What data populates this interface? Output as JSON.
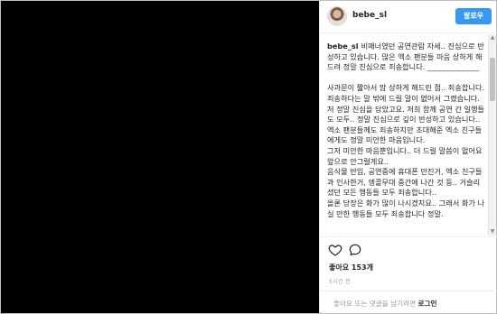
{
  "header": {
    "username": "bebe_sl",
    "follow_label": "팔로우"
  },
  "caption": {
    "username": "bebe_sl",
    "paragraphs": [
      "비매너였던 공연관람 자세.. 진심으로 반성하고 있습니다. 많은 엑소 팬분들 마음 상하게 해드려 정말 진심으로 죄송합니다. ______________",
      "",
      "사과문이 짧아서 맘 상하게 해드린 점.. 죄송합니다. 죄송하다는 말 밖에 드릴 말이 없어서 그랬습니다. 저 정말 진심을 담았고요. 저희 함께 공연 간 일행들도 모두.. 정말 진심으로 깊이 반성하고 있습니다.. 엑소 팬분들께도 죄송하지만 초대해준 엑소 친구들에게도 정말 미안한 마음입니다.",
      "그저 미안한 마음뿐입니다.. 더 드릴 말씀이 없어요",
      "앞으로 안그럴게요..",
      "음식물 반입, 공연중에 휴대폰 만진거, 엑소 친구들과 인사한거, 엥콜무대 중간에 나간 것 등.. 거슬리셨던 모든 행동들 모두 죄송합니다..",
      "올론 당장은 화가 많이 나시겠지요.. 그래서 화가 나실 만한 행동들 모두 죄송합니다 정말."
    ]
  },
  "actions": {
    "likes_text": "좋아요 153개",
    "time_text": "5시간 전"
  },
  "comment": {
    "placeholder_text": "좋아요 또는 댓글을 남기려면",
    "login_label": "로그인"
  }
}
